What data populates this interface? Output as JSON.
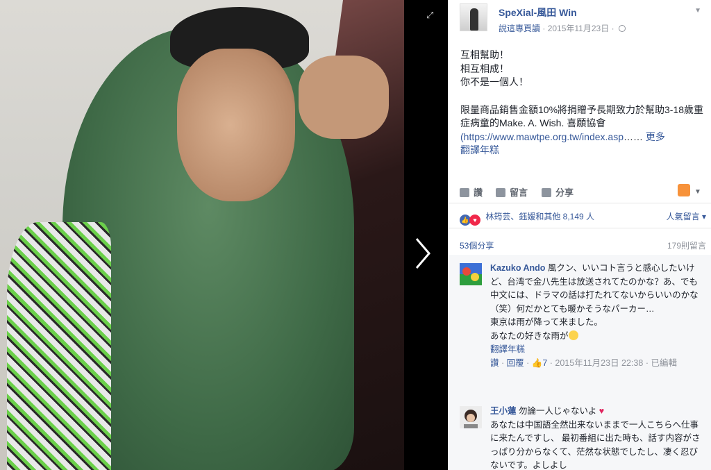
{
  "page": {
    "name": "SpeXial-風田 Win",
    "see_label": "說這專頁讀",
    "date": "2015年11月23日",
    "separator": "·"
  },
  "post": {
    "lines": [
      "互相幫助！",
      "相互相成！",
      "你不是一個人！"
    ],
    "para1": "限量商品銷售金額10%將捐贈予長期致力於幫助3-18歲重症病童的Make. A. Wish. 喜願協會",
    "link": "(https://www.mawtpe.org.tw/index.asp",
    "ellipsis": "……",
    "more": "更多",
    "translate": "翻譯年糕"
  },
  "actions": {
    "like": "讚",
    "comment": "留言",
    "share": "分享"
  },
  "reactions": {
    "names": "林筠芸、鈺嫒和其他 8,149 人",
    "sort": "人氣留言"
  },
  "counts": {
    "shares": "53個分享",
    "comments": "179則留言"
  },
  "comments": [
    {
      "name": "Kazuko Ando",
      "text_first": "風クン、いいコト言うと感心したいけど、台湾で金八先生は放送されてたのかな？あ、でも中文には、ドラマの話は打たれてないからいいのかな（笑）何だかとても暖かそうなパーカー…",
      "line2": "東京は雨が降って来ました。",
      "line3": "あなたの好きな雨が",
      "translate": "翻譯年糕",
      "meta_like": "讚",
      "meta_reply": "回覆",
      "meta_likes": "7",
      "meta_date": "2015年11月23日 22:38",
      "meta_edited": "已編輯"
    },
    {
      "name": "王小蓮",
      "text_first": "勿論一人じゃないよ",
      "text_rest": "あなたは中国語全然出来ないままで一人こちらへ仕事に来たんですし、 最初番組に出た時も、話す内容がさっぱり分からなくて、茫然な状態でしたし、凄く忍びないです。よしよし"
    }
  ],
  "icons": {
    "expand": "expand-icon",
    "next": "chevron-right-icon",
    "globe": "globe-icon",
    "like": "thumbs-up-icon",
    "comment": "comment-icon",
    "share": "share-icon",
    "heart": "heart-icon"
  },
  "colors": {
    "link": "#365899",
    "meta": "#90949c",
    "like_blue": "#4267b2",
    "heart_red": "#f0284a"
  }
}
